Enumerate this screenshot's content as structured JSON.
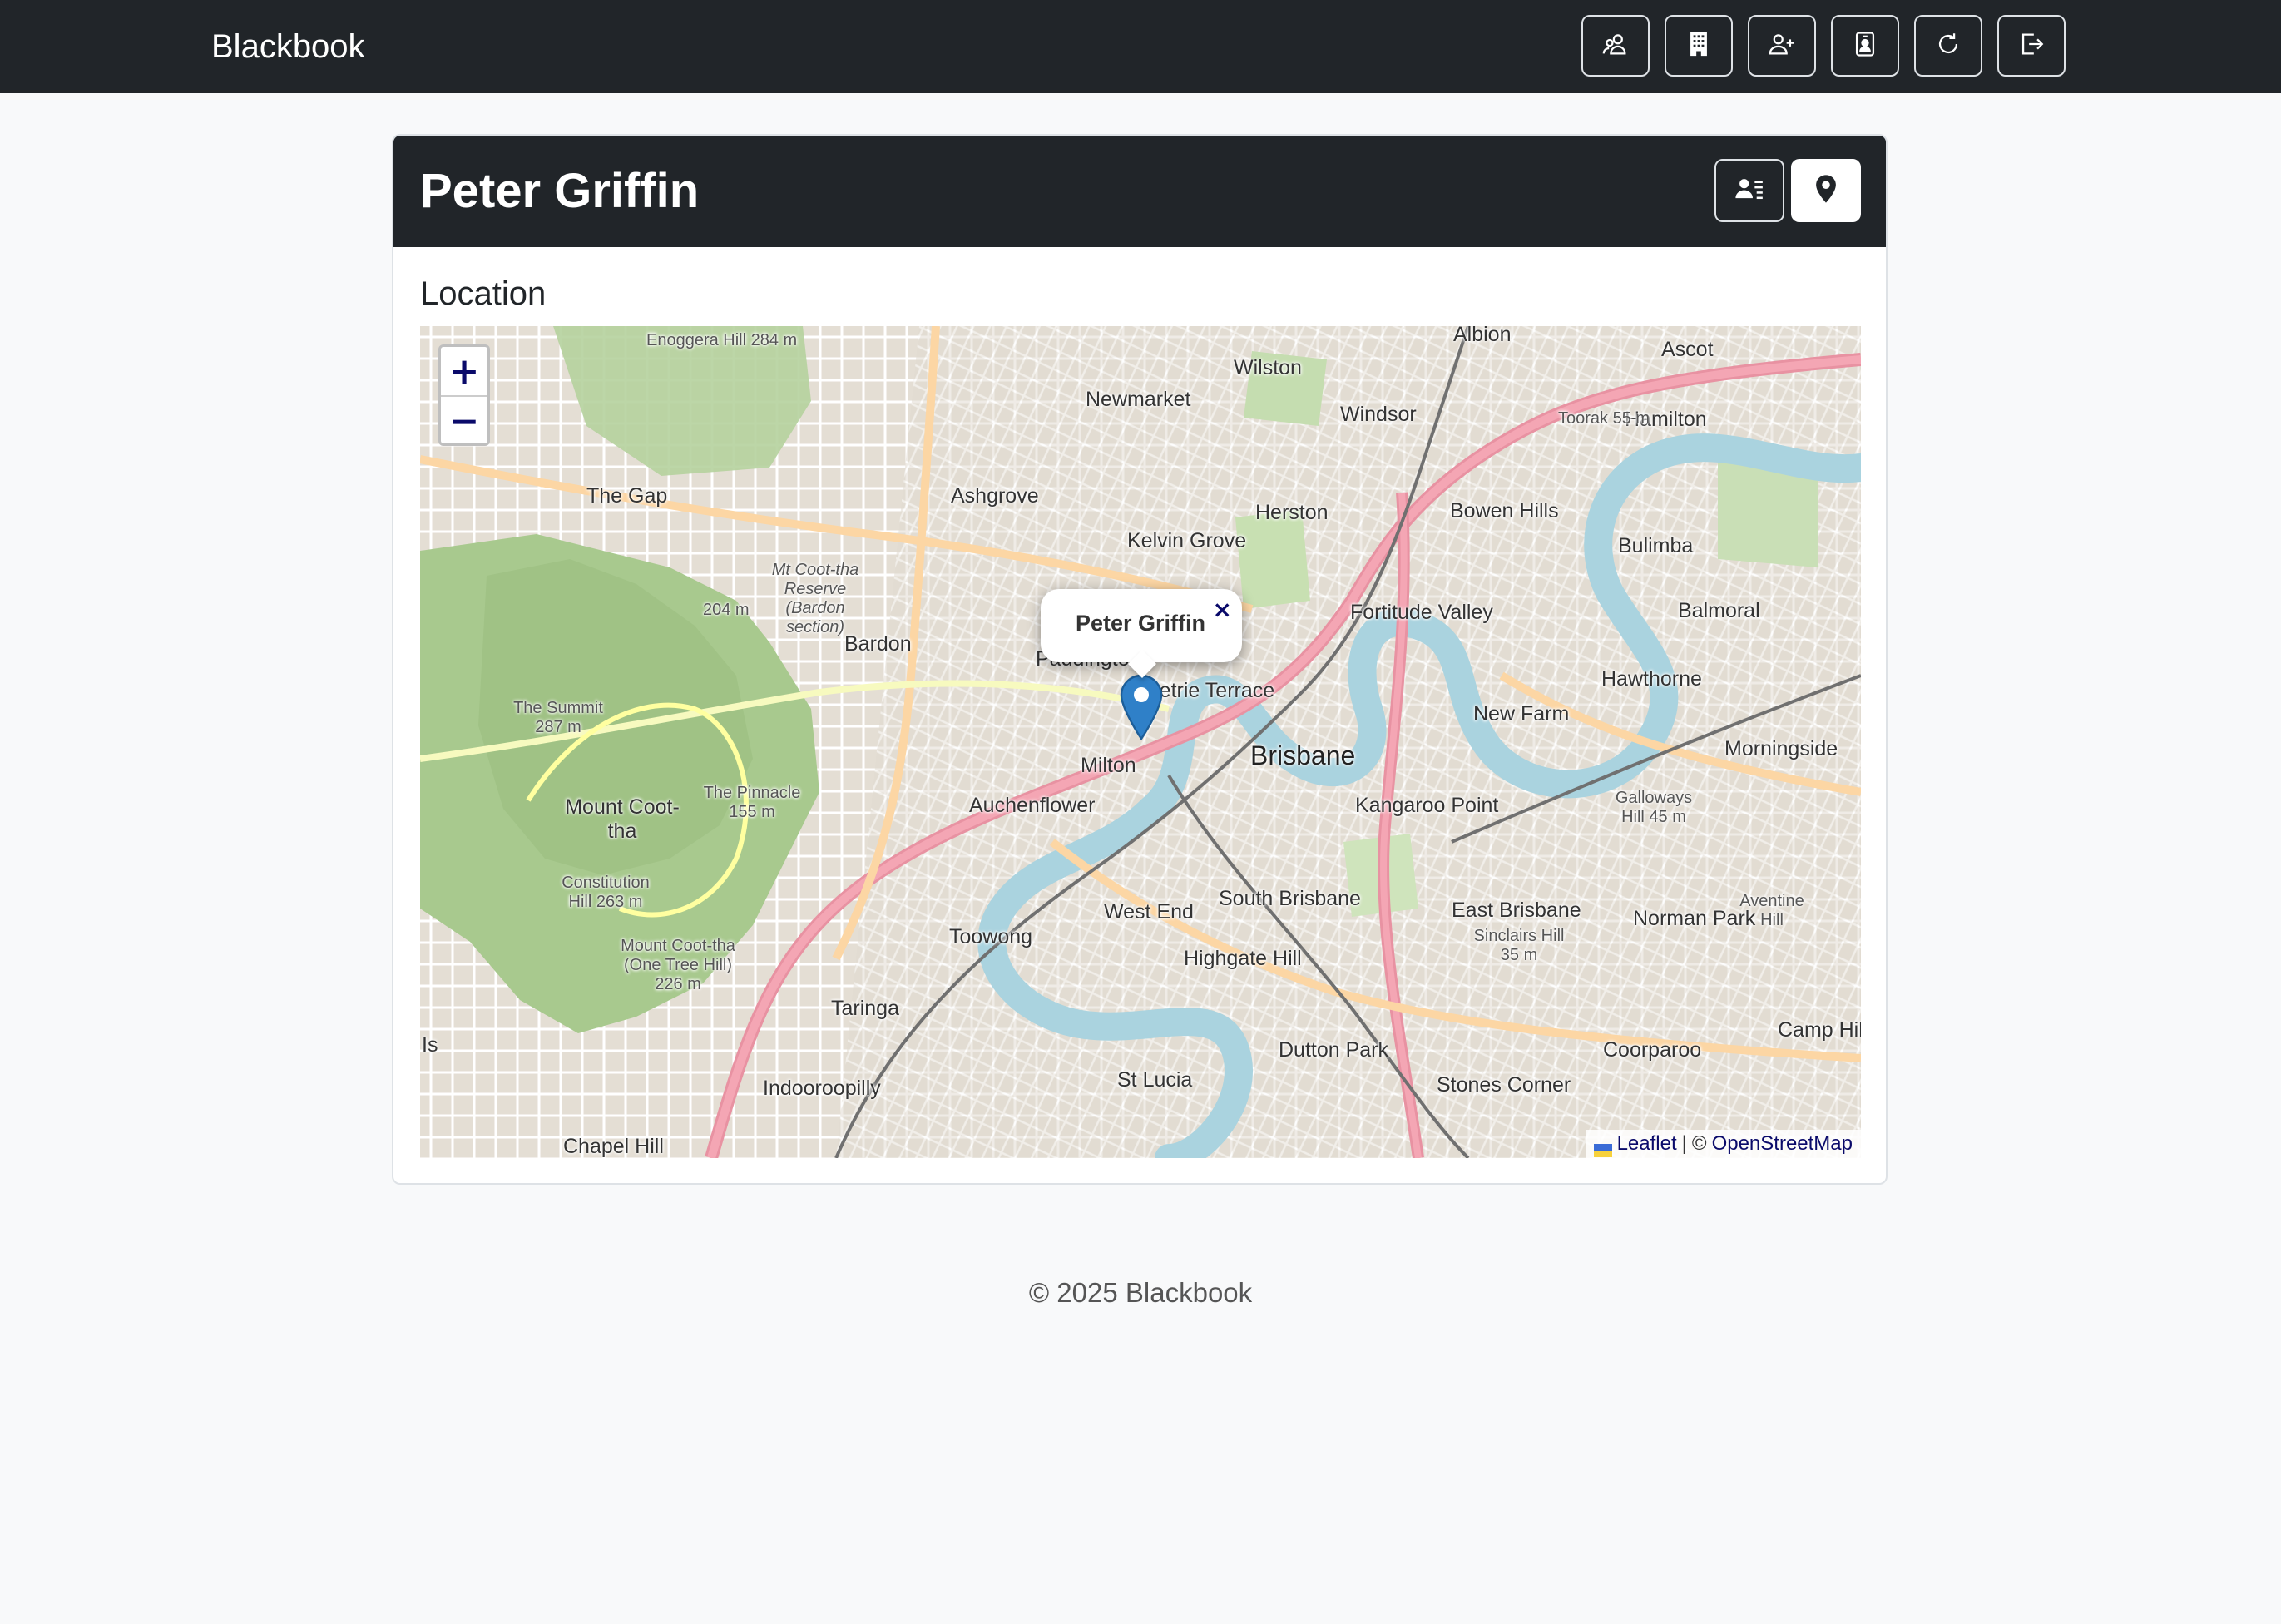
{
  "navbar": {
    "brand": "Blackbook",
    "buttons": [
      {
        "icon": "people-icon"
      },
      {
        "icon": "building-icon"
      },
      {
        "icon": "person-add-icon"
      },
      {
        "icon": "person-badge-icon"
      },
      {
        "icon": "refresh-icon"
      },
      {
        "icon": "logout-icon"
      }
    ]
  },
  "card": {
    "title": "Peter Griffin",
    "buttons": [
      {
        "icon": "person-lines-icon",
        "active": false
      },
      {
        "icon": "location-pin-icon",
        "active": true
      }
    ]
  },
  "location": {
    "section_title": "Location",
    "popup_text": "Peter Griffin",
    "popup_close": "×",
    "zoom_in": "+",
    "zoom_out": "−",
    "attribution": {
      "leaflet": "Leaflet",
      "separator": "|",
      "copyright": "©",
      "osm": "OpenStreetMap"
    },
    "labels": [
      {
        "text": "Enoggera Hill 284 m",
        "kind": "small"
      },
      {
        "text": "Newmarket"
      },
      {
        "text": "Wilston"
      },
      {
        "text": "Albion"
      },
      {
        "text": "Ascot"
      },
      {
        "text": "Windsor"
      },
      {
        "text": "Hamilton"
      },
      {
        "text": "Toorak 55 m",
        "kind": "small"
      },
      {
        "text": "The Gap"
      },
      {
        "text": "Ashgrove"
      },
      {
        "text": "Herston"
      },
      {
        "text": "Bowen Hills"
      },
      {
        "text": "Kelvin Grove"
      },
      {
        "text": "Bulimba"
      },
      {
        "text": "Mt Coot-tha Reserve (Bardon section)",
        "kind": "small"
      },
      {
        "text": "204 m",
        "kind": "small"
      },
      {
        "text": "Bardon"
      },
      {
        "text": "Paddington"
      },
      {
        "text": "Fortitude Valley"
      },
      {
        "text": "Balmoral"
      },
      {
        "text": "Petrie Terrace"
      },
      {
        "text": "Hawthorne"
      },
      {
        "text": "The Summit 287 m",
        "kind": "small"
      },
      {
        "text": "Milton"
      },
      {
        "text": "Brisbane",
        "kind": "city"
      },
      {
        "text": "New Farm"
      },
      {
        "text": "Morningside"
      },
      {
        "text": "The Pinnacle 155 m",
        "kind": "small"
      },
      {
        "text": "Mount Coot-tha"
      },
      {
        "text": "Auchenflower"
      },
      {
        "text": "Kangaroo Point"
      },
      {
        "text": "Galloways Hill 45 m",
        "kind": "small"
      },
      {
        "text": "Constitution Hill 263 m",
        "kind": "small"
      },
      {
        "text": "Toowong"
      },
      {
        "text": "South Brisbane"
      },
      {
        "text": "West End"
      },
      {
        "text": "East Brisbane"
      },
      {
        "text": "Norman Park"
      },
      {
        "text": "Aventine Hill",
        "kind": "small"
      },
      {
        "text": "Sinclairs Hill 35 m",
        "kind": "small"
      },
      {
        "text": "Highgate Hill"
      },
      {
        "text": "Mount Coot-tha (One Tree Hill) 226 m",
        "kind": "small"
      },
      {
        "text": "Taringa"
      },
      {
        "text": "Dutton Park"
      },
      {
        "text": "Coorparoo"
      },
      {
        "text": "Camp Hill"
      },
      {
        "text": "St Lucia"
      },
      {
        "text": "Indooroopilly"
      },
      {
        "text": "Stones Corner"
      },
      {
        "text": "Chapel Hill"
      },
      {
        "text": "Is"
      }
    ]
  },
  "footer": {
    "text": "© 2025 Blackbook"
  }
}
